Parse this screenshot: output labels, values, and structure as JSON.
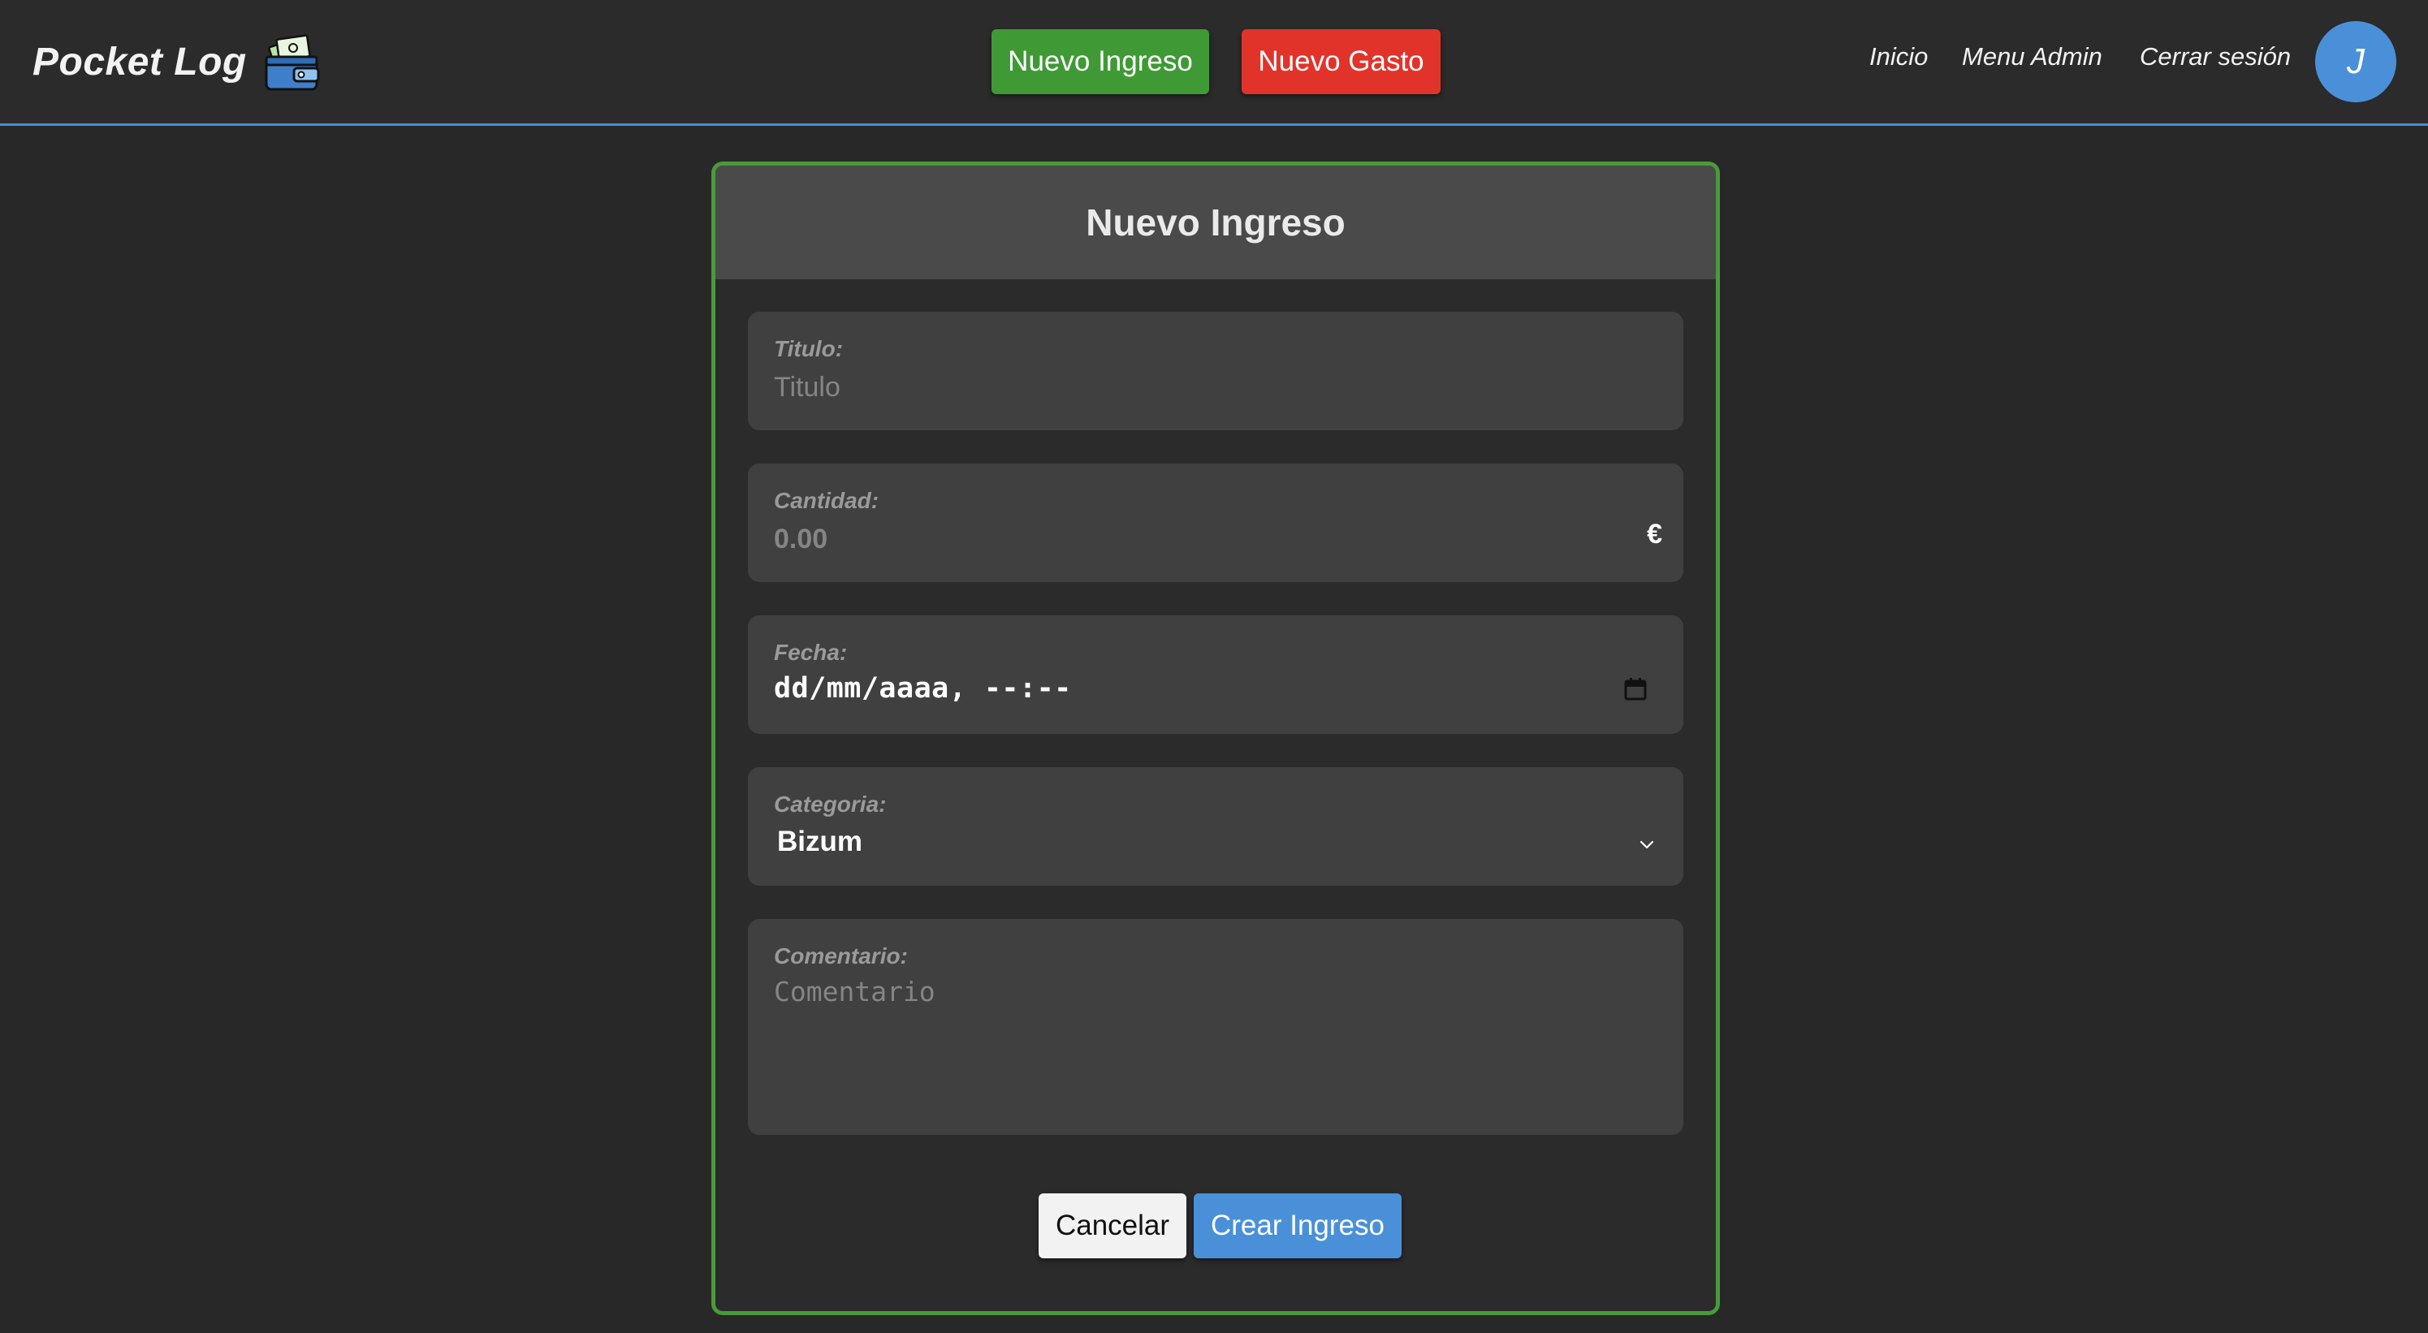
{
  "header": {
    "brand": "Pocket Log",
    "brand_icon": "wallet-icon",
    "new_income_label": "Nuevo Ingreso",
    "new_expense_label": "Nuevo Gasto",
    "nav": {
      "home": "Inicio",
      "admin": "Menu Admin",
      "logout": "Cerrar sesión"
    },
    "avatar_initial": "J"
  },
  "form": {
    "title": "Nuevo Ingreso",
    "titulo": {
      "label": "Titulo:",
      "placeholder": "Titulo",
      "value": ""
    },
    "cantidad": {
      "label": "Cantidad:",
      "placeholder": "0.00",
      "value": "",
      "currency": "€"
    },
    "fecha": {
      "label": "Fecha:",
      "display": "dd/mm/aaaa, --:--"
    },
    "categoria": {
      "label": "Categoria:",
      "selected": "Bizum"
    },
    "comentario": {
      "label": "Comentario:",
      "placeholder": "Comentario",
      "value": ""
    },
    "cancel_label": "Cancelar",
    "submit_label": "Crear Ingreso"
  },
  "colors": {
    "background": "#282828",
    "income_green": "#3f9a35",
    "expense_red": "#e2332a",
    "accent_blue": "#4a90d9",
    "card_border": "#4a9a3a"
  }
}
